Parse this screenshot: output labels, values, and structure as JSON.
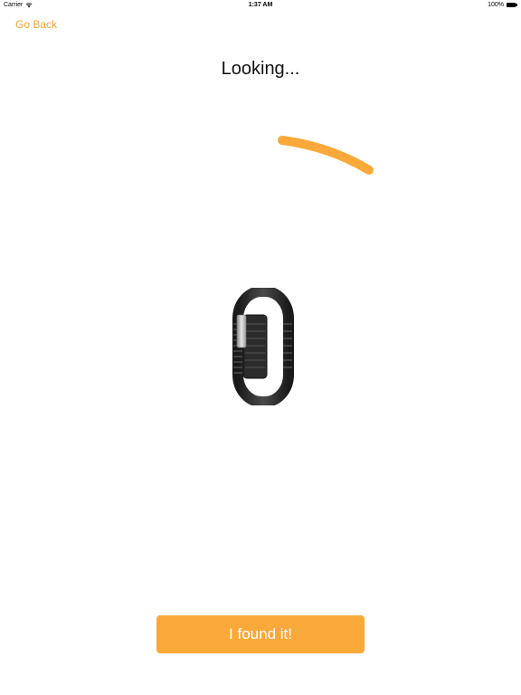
{
  "status_bar": {
    "carrier": "Carrier",
    "time": "1:37 AM",
    "battery": "100%"
  },
  "nav": {
    "back_label": "Go Back"
  },
  "main": {
    "title": "Looking...",
    "spinner_icon": "arc-spinner",
    "device_image": "wristband"
  },
  "footer": {
    "found_label": "I found it!"
  },
  "colors": {
    "accent": "#F9A93A",
    "back_link": "#F7A32E"
  }
}
